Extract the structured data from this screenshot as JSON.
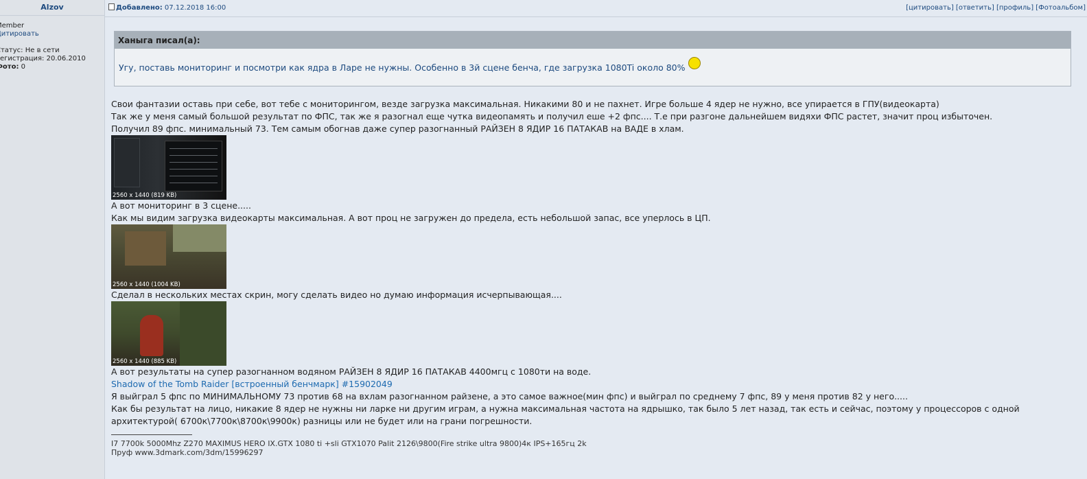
{
  "sidebar": {
    "author": "Alzov",
    "rank": "Member",
    "cite": "Цитировать",
    "status_label": "Статус:",
    "status_value": "Не в сети",
    "reg_label": "Регистрация:",
    "reg_value": "20.06.2010",
    "photo_label": "Фото:",
    "photo_value": "0"
  },
  "topbar": {
    "added_label": "Добавлено:",
    "added_date": "07.12.2018 16:00",
    "actions": [
      "[цитировать]",
      "[ответить]",
      "[профиль]",
      "[Фотоальбом]"
    ]
  },
  "quote": {
    "header": "Ханыга писал(а):",
    "body": "Угу, поставь мониторинг и посмотри как ядра в Ларе не нужны. Особенно в 3й сцене бенча, где загрузка 1080Ti около 80%"
  },
  "post": {
    "p1": "Свои фантазии оставь при себе, вот тебе с мониторингом, везде загрузка максимальная. Никакими 80 и не пахнет. Игре больше 4 ядер не нужно, все упирается в ГПУ(видеокарта)",
    "p2": "Так же у меня самый большой результат по ФПС, так же я разогнал еще чутка видеопамять и получил еше +2 фпс.... Т.е при разгоне дальнейшем видяхи ФПС растет, значит проц избыточен.",
    "p3": "Получил 89 фпс. минимальный 73. Тем самым обогнав даже супер разогнанный РАЙЗЕН 8 ЯДИР 16 ПАТАКАВ на ВАДЕ в хлам.",
    "img1_caption": "2560 x 1440 (819 KB)",
    "p4": "А вот мониторинг в 3 сцене.....",
    "p5": "Как мы видим загрузка видеокарты максимальная. А вот проц не загружен до предела, есть небольшой запас, все уперлось в ЦП.",
    "img2_caption": "2560 x 1440 (1004 KB)",
    "p6": "Сделал в нескольких местах скрин, могу сделать видео но думаю информация исчерпывающая....",
    "img3_caption": "2560 x 1440 (885 KB)",
    "p7": "А вот результаты на супер разогнанном водяном РАЙЗЕН 8 ЯДИР 16 ПАТАКАВ 4400мгц с 1080ти на воде.",
    "link": "Shadow of the Tomb Raider [встроенный бенчмарк] #15902049",
    "p8": "Я выйграл 5 фпс по МИНИМАЛЬНОМУ 73 против 68 на вхлам разогнанном райзене, а это самое важное(мин фпс) и выйграл по среднему 7 фпс, 89 у меня против 82 у него.....",
    "p9": "Как бы результат на лицо, никакие 8 ядер не нужны ни ларке ни другим играм, а нужна максимальная частота на ядрышко, так было 5 лет назад, так есть и сейчас, поэтому у процессоров с одной",
    "p10": "архитектурой( 6700к\\7700к\\8700к\\9900к) разницы или не будет или на грани погрешности."
  },
  "signature": {
    "line1": "I7 7700k 5000Mhz Z270 MAXIMUS HERO IX.GTX 1080 ti +sli GTX1070 Palit 2126\\9800(Fire strike ultra 9800)4к IPS+165гц 2k",
    "line2": "Пруф www.3dmark.com/3dm/15996297"
  }
}
